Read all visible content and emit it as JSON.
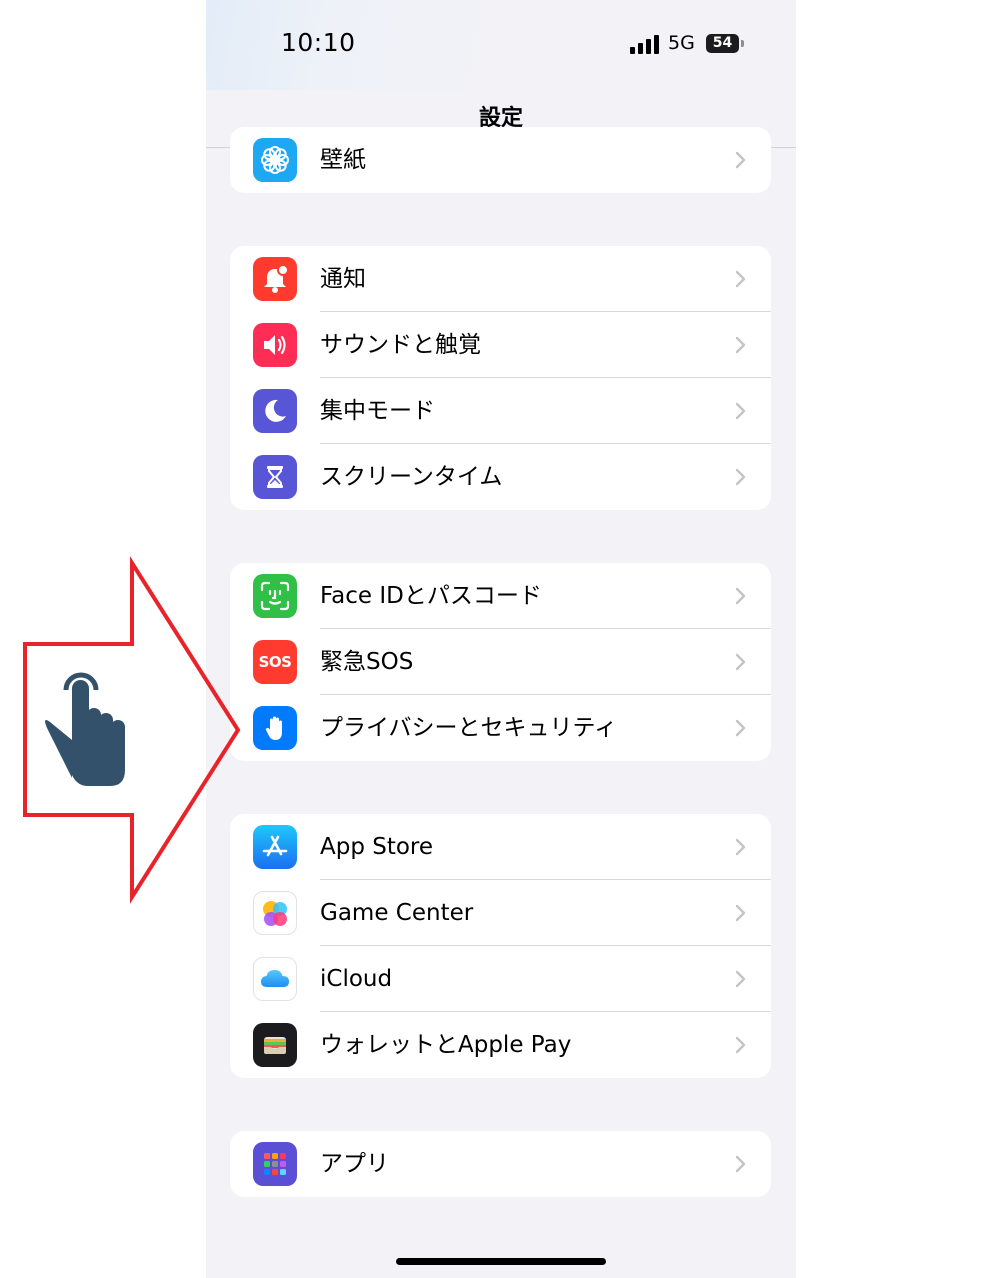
{
  "status_bar": {
    "time": "10:10",
    "network": "5G",
    "battery": "54"
  },
  "nav": {
    "title": "設定"
  },
  "groups": [
    {
      "items": [
        {
          "label": "壁紙",
          "icon": "wallpaper-icon",
          "color": "#1ea7f2"
        }
      ]
    },
    {
      "items": [
        {
          "label": "通知",
          "icon": "notifications-icon",
          "color": "#ff3b30"
        },
        {
          "label": "サウンドと触覚",
          "icon": "sound-icon",
          "color": "#ff2d55"
        },
        {
          "label": "集中モード",
          "icon": "moon-icon",
          "color": "#5856d6"
        },
        {
          "label": "スクリーンタイム",
          "icon": "hourglass-icon",
          "color": "#5856d6"
        }
      ]
    },
    {
      "items": [
        {
          "label": "Face IDとパスコード",
          "icon": "face-id-icon",
          "color": "#30c048"
        },
        {
          "label": "緊急SOS",
          "icon": "sos-icon",
          "color": "#ff3b30",
          "icon_text": "SOS"
        },
        {
          "label": "プライバシーとセキュリティ",
          "icon": "hand-icon",
          "color": "#007aff"
        }
      ]
    },
    {
      "items": [
        {
          "label": "App Store",
          "icon": "app-store-icon",
          "color": "#1e8ef5"
        },
        {
          "label": "Game Center",
          "icon": "game-center-icon",
          "color": "#ffffff"
        },
        {
          "label": "iCloud",
          "icon": "icloud-icon",
          "color": "#ffffff"
        },
        {
          "label": "ウォレットとApple Pay",
          "icon": "wallet-icon",
          "color": "#1c1c1e"
        }
      ]
    },
    {
      "items": [
        {
          "label": "アプリ",
          "icon": "apps-icon",
          "color": "#5b4fd6"
        }
      ]
    }
  ],
  "overlay": {
    "arrow_color": "#e8232a",
    "hand_color": "#34516b"
  }
}
